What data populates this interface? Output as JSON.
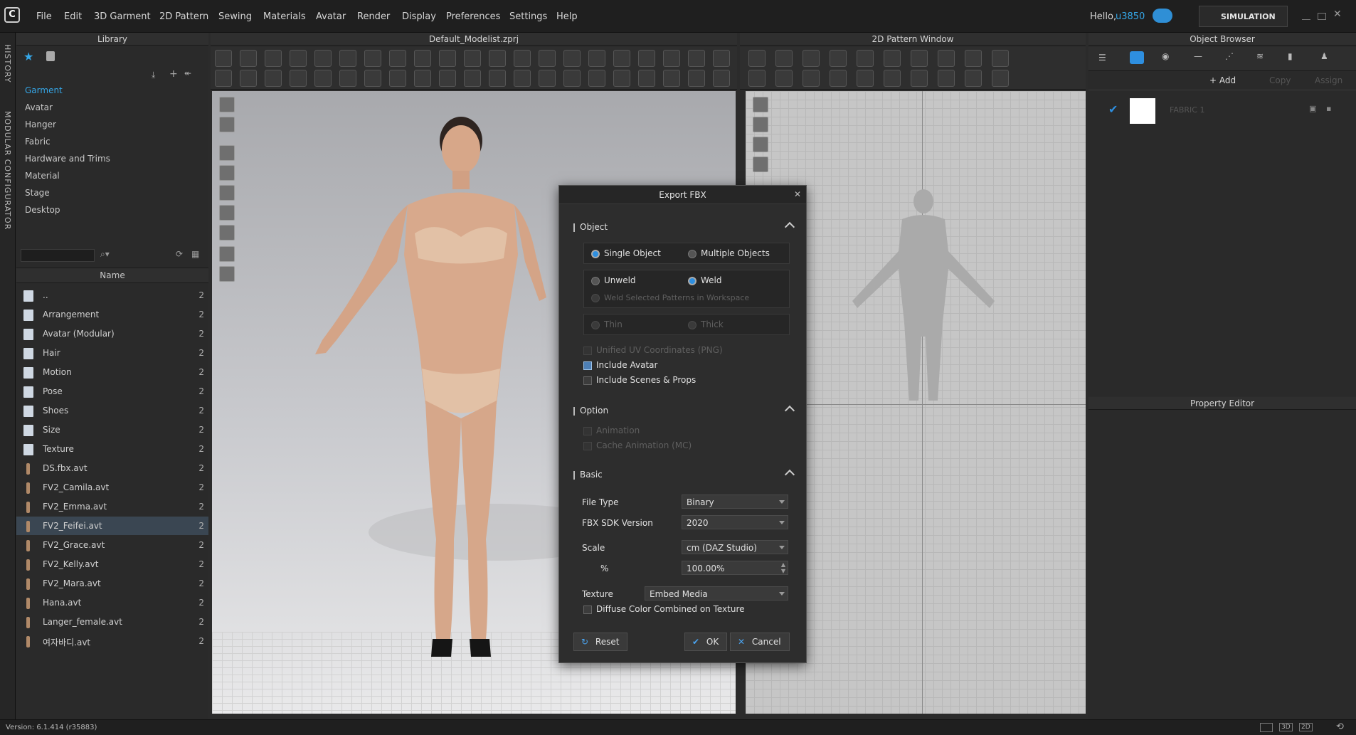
{
  "menu": {
    "items": [
      "File",
      "Edit",
      "3D Garment",
      "2D Pattern",
      "Sewing",
      "Materials",
      "Avatar",
      "Render",
      "Display",
      "Preferences",
      "Settings",
      "Help"
    ],
    "greeting": "Hello,",
    "username": "u3850",
    "simulation": "SIMULATION"
  },
  "side_tabs": {
    "history": "HISTORY",
    "modular": "MODULAR CONFIGURATOR"
  },
  "library": {
    "title": "Library",
    "categories": [
      "Garment",
      "Avatar",
      "Hanger",
      "Fabric",
      "Hardware and Trims",
      "Material",
      "Stage",
      "Desktop"
    ],
    "selected_category": "Garment",
    "column_name": "Name",
    "rows": [
      {
        "label": "..",
        "count": "2",
        "icon": "folder-icon"
      },
      {
        "label": "Arrangement",
        "count": "2",
        "icon": "folder-icon"
      },
      {
        "label": "Avatar (Modular)",
        "count": "2",
        "icon": "folder-icon"
      },
      {
        "label": "Hair",
        "count": "2",
        "icon": "folder-icon"
      },
      {
        "label": "Motion",
        "count": "2",
        "icon": "folder-icon"
      },
      {
        "label": "Pose",
        "count": "2",
        "icon": "folder-icon"
      },
      {
        "label": "Shoes",
        "count": "2",
        "icon": "folder-icon"
      },
      {
        "label": "Size",
        "count": "2",
        "icon": "folder-icon"
      },
      {
        "label": "Texture",
        "count": "2",
        "icon": "folder-icon"
      },
      {
        "label": "DS.fbx.avt",
        "count": "2",
        "icon": "avatar-file-icon"
      },
      {
        "label": "FV2_Camila.avt",
        "count": "2",
        "icon": "avatar-file-icon"
      },
      {
        "label": "FV2_Emma.avt",
        "count": "2",
        "icon": "avatar-file-icon"
      },
      {
        "label": "FV2_Feifei.avt",
        "count": "2",
        "icon": "avatar-file-icon",
        "selected": true
      },
      {
        "label": "FV2_Grace.avt",
        "count": "2",
        "icon": "avatar-file-icon"
      },
      {
        "label": "FV2_Kelly.avt",
        "count": "2",
        "icon": "avatar-file-icon"
      },
      {
        "label": "FV2_Mara.avt",
        "count": "2",
        "icon": "avatar-file-icon"
      },
      {
        "label": "Hana.avt",
        "count": "2",
        "icon": "avatar-file-icon"
      },
      {
        "label": "Langer_female.avt",
        "count": "2",
        "icon": "avatar-file-icon"
      },
      {
        "label": "여자바디.avt",
        "count": "2",
        "icon": "avatar-file-icon"
      }
    ]
  },
  "viewport3d": {
    "title": "Default_Modelist.zprj"
  },
  "viewport2d": {
    "title": "2D Pattern Window"
  },
  "object_browser": {
    "title": "Object Browser",
    "add": "+ Add",
    "copy": "Copy",
    "assign": "Assign",
    "fabric_name": "FABRIC 1"
  },
  "property_editor": {
    "title": "Property Editor"
  },
  "status": {
    "version": "Version: 6.1.414 (r35883)",
    "view_3d": "3D",
    "view_2d": "2D"
  },
  "dialog": {
    "title": "Export FBX",
    "object_section": "Object",
    "single_object": "Single Object",
    "multiple_objects": "Multiple Objects",
    "unweld": "Unweld",
    "weld": "Weld",
    "weld_selected": "Weld Selected Patterns in Workspace",
    "thin": "Thin",
    "thick": "Thick",
    "unified_uv": "Unified UV Coordinates (PNG)",
    "include_avatar": "Include Avatar",
    "include_scenes": "Include Scenes & Props",
    "option_section": "Option",
    "animation": "Animation",
    "cache_animation": "Cache Animation (MC)",
    "basic_section": "Basic",
    "file_type_label": "File Type",
    "file_type_value": "Binary",
    "sdk_label": "FBX SDK Version",
    "sdk_value": "2020",
    "scale_label": "Scale",
    "scale_value": "cm (DAZ Studio)",
    "percent_label": "%",
    "percent_value": "100.00%",
    "texture_label": "Texture",
    "texture_value": "Embed Media",
    "diffuse_combined": "Diffuse Color Combined on Texture",
    "reset": "Reset",
    "ok": "OK",
    "cancel": "Cancel"
  },
  "colors": {
    "accent": "#2e8fe0",
    "selection": "#3a4652",
    "link": "#35a7e8"
  }
}
